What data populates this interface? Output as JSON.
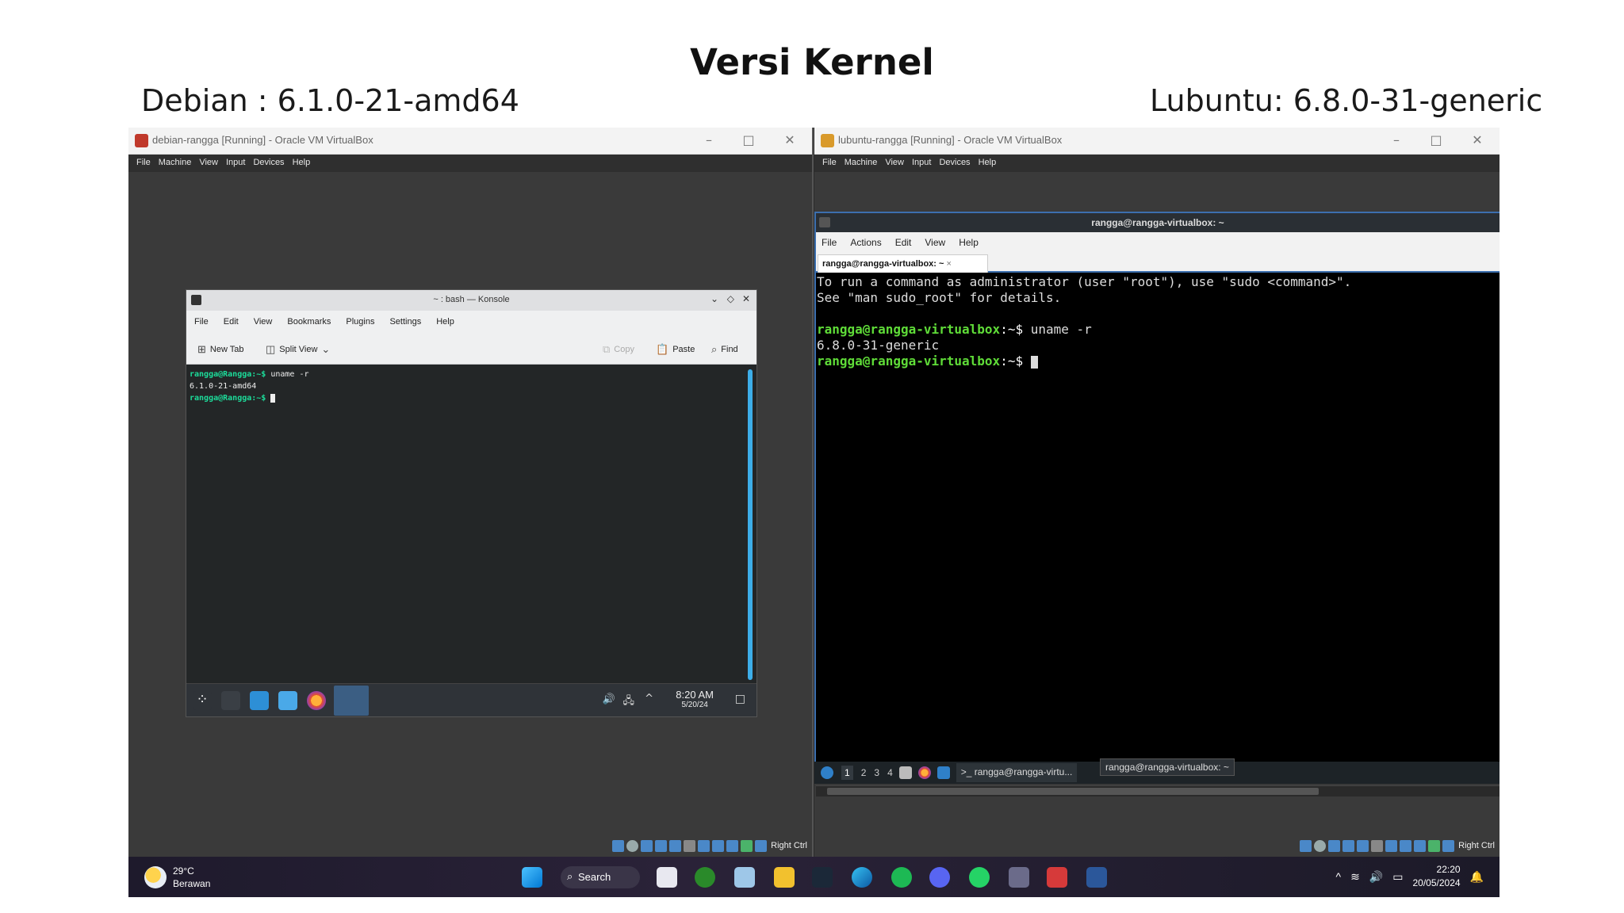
{
  "slide": {
    "title": "Versi Kernel",
    "debian_label": "Debian : 6.1.0-21-amd64",
    "lubuntu_label": "Lubuntu: 6.8.0-31-generic"
  },
  "vbox_left": {
    "title": "debian-rangga [Running] - Oracle VM VirtualBox",
    "menu": [
      "File",
      "Machine",
      "View",
      "Input",
      "Devices",
      "Help"
    ],
    "host_key": "Right Ctrl"
  },
  "vbox_right": {
    "title": "lubuntu-rangga [Running] - Oracle VM VirtualBox",
    "menu": [
      "File",
      "Machine",
      "View",
      "Input",
      "Devices",
      "Help"
    ],
    "host_key": "Right Ctrl"
  },
  "konsole": {
    "title": "~ : bash — Konsole",
    "menu": [
      "File",
      "Edit",
      "View",
      "Bookmarks",
      "Plugins",
      "Settings",
      "Help"
    ],
    "toolbar": {
      "new_tab": "New Tab",
      "split_view": "Split View",
      "copy": "Copy",
      "paste": "Paste",
      "find": "Find"
    },
    "lines": [
      {
        "prompt": "rangga@Rangga:~$",
        "cmd": " uname -r"
      },
      {
        "output": "6.1.0-21-amd64"
      },
      {
        "prompt": "rangga@Rangga:~$",
        "cmd": " "
      }
    ],
    "panel": {
      "time": "8:20 AM",
      "date": "5/20/24"
    }
  },
  "qterminal": {
    "title": "rangga@rangga-virtualbox: ~",
    "menu": [
      "File",
      "Actions",
      "Edit",
      "View",
      "Help"
    ],
    "tab_label": "rangga@rangga-virtualbox: ~",
    "lines": [
      {
        "output": "To run a command as administrator (user \"root\"), use \"sudo <command>\"."
      },
      {
        "output": "See \"man sudo_root\" for details."
      },
      {
        "output": ""
      },
      {
        "prompt": "rangga@rangga-virtualbox",
        "path": ":~$",
        "cmd": " uname -r"
      },
      {
        "output": "6.8.0-31-generic"
      },
      {
        "prompt": "rangga@rangga-virtualbox",
        "path": ":~$",
        "cmd": " "
      }
    ],
    "panel": {
      "desktops": [
        "1",
        "2",
        "3",
        "4"
      ],
      "task_label": "rangga@rangga-virtu...",
      "tooltip": "rangga@rangga-virtualbox: ~"
    }
  },
  "windows_taskbar": {
    "weather_temp": "29°C",
    "weather_desc": "Berawan",
    "search_label": "Search",
    "time": "22:20",
    "date": "20/05/2024"
  }
}
